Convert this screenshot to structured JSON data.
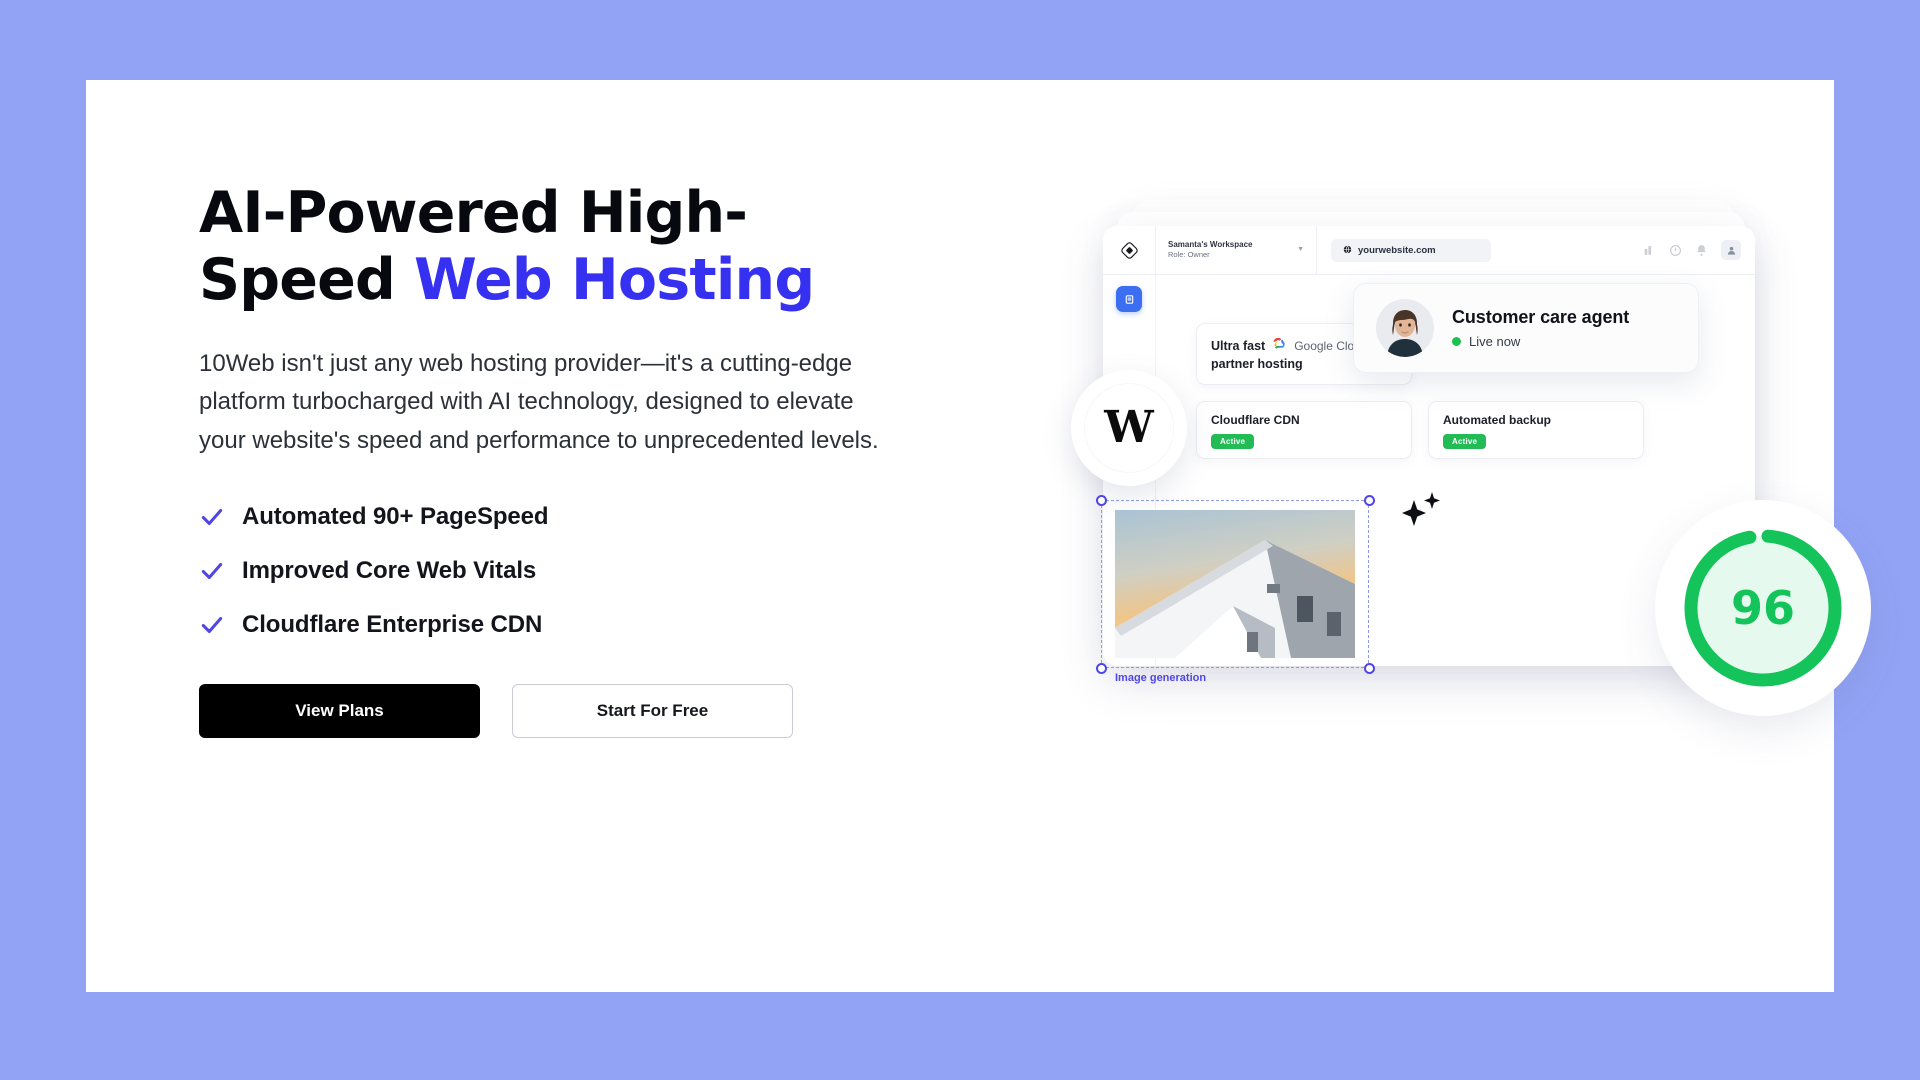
{
  "theme": {
    "background": "#92a3f5",
    "card_background": "#ffffff",
    "accent_blue": "#3630f0",
    "check_blue": "#4f46e5",
    "green": "#22bb55",
    "score_green": "#14c359"
  },
  "hero": {
    "headline_line1": "AI-Powered High-",
    "headline_line2_plain": "Speed ",
    "headline_line2_accent": "Web Hosting",
    "subcopy": "10Web isn't just any web hosting provider—it's a cutting-edge platform turbocharged with AI technology, designed to elevate your website's speed and performance to unprecedented levels.",
    "features": [
      {
        "label": "Automated 90+ PageSpeed",
        "icon": "check-icon"
      },
      {
        "label": "Improved Core Web Vitals",
        "icon": "check-icon"
      },
      {
        "label": "Cloudflare Enterprise CDN",
        "icon": "check-icon"
      }
    ],
    "buttons": {
      "primary": "View Plans",
      "secondary": "Start For Free"
    }
  },
  "mockup": {
    "browser_bar": {
      "workspace_name": "Samanta's Workspace",
      "workspace_role": "Role: Owner",
      "dropdown_icon": "chevron-down-icon",
      "url": "yourwebsite.com",
      "url_icon": "globe-icon",
      "logo_icon": "10web-logo-icon",
      "toolbar_icons": [
        "analytics-icon",
        "help-icon",
        "notification-bell-icon",
        "user-avatar-icon"
      ]
    },
    "sidebar": {
      "active_item_icon": "dashboard-icon"
    },
    "cards": [
      {
        "id": "gcloud",
        "strong": "Ultra fast",
        "brand": "Google Cloud",
        "brand_icon": "google-cloud-icon",
        "sub": "partner hosting"
      },
      {
        "id": "cdn",
        "title": "Cloudflare CDN",
        "badge": "Active"
      },
      {
        "id": "backup",
        "title": "Automated backup",
        "badge": "Active"
      }
    ],
    "care_card": {
      "name": "Customer care agent",
      "status": "Live now",
      "status_icon": "online-dot-icon",
      "avatar_icon": "agent-avatar"
    },
    "wordpress_badge": {
      "glyph": "W",
      "icon": "wordpress-logo-icon"
    },
    "image_generation": {
      "label": "Image generation",
      "handles_icon": "resize-handle-icon",
      "photo_icon": "architecture-photo"
    },
    "sparkle_icon": "ai-sparkle-icon",
    "pagespeed": {
      "score": "96",
      "ring_percent": 96
    }
  }
}
